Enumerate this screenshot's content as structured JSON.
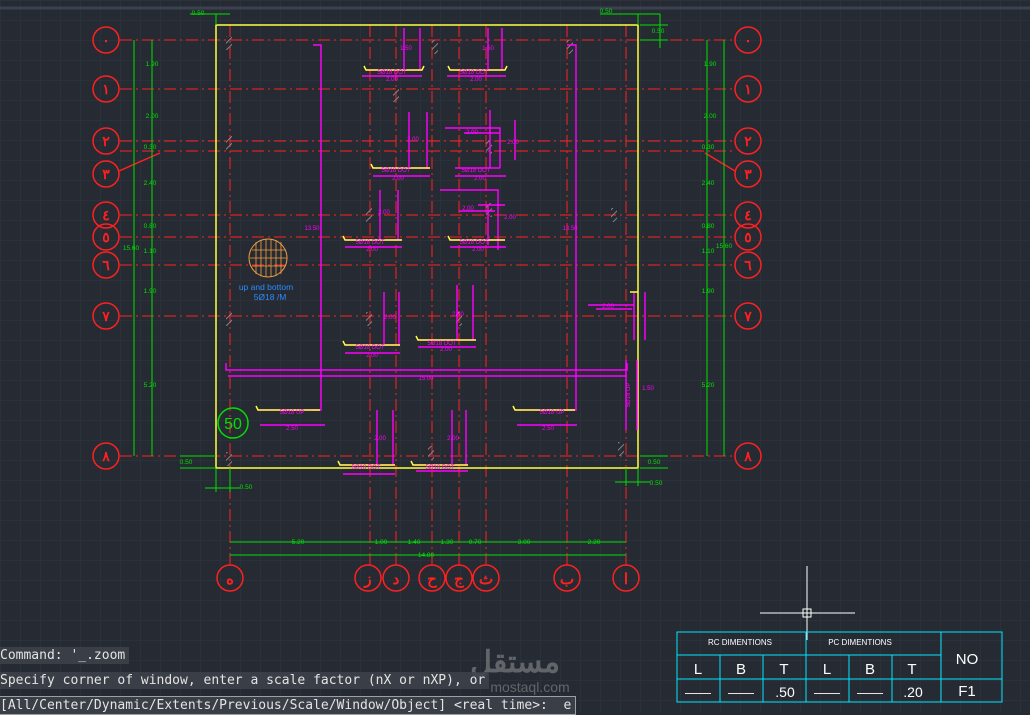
{
  "drawing": {
    "row_labels": [
      "٠",
      "١",
      "٢",
      "٣",
      "٤",
      "٥",
      "٦",
      "٧",
      "٨"
    ],
    "col_labels": [
      "ه",
      "ز",
      "د",
      "ح",
      "ج",
      "ث",
      "ب",
      "ا"
    ],
    "left_dims": [
      "1.90",
      "2.00",
      "0.30",
      "2.40",
      "0.80",
      "1.10",
      "1.90",
      "5.20"
    ],
    "right_dims": [
      "1.90",
      "2.00",
      "0.30",
      "2.40",
      "0.80",
      "1.10",
      "1.90",
      "5.20"
    ],
    "overall_v": "15.60",
    "bottom_dims": [
      "5.20",
      "1.00",
      "1.40",
      "1.30",
      "0.70",
      "3.00",
      "2.20"
    ],
    "overall_h": "14.80",
    "edge_dims": [
      "0.50",
      "0.50",
      "0.50",
      "0.50",
      "0.50",
      "0.50",
      "0.50"
    ],
    "span_15": "15.00",
    "span_1350": "13.50",
    "column_note_line1": "up and bottom",
    "column_note_line2": "5Ø18 /M",
    "slab_thickness": "50",
    "bar_labels": [
      "5Ø18 DOT",
      "5Ø18 DOT",
      "5Ø18 DOT",
      "5Ø18 DOT",
      "5Ø18 DOT",
      "5Ø18 DOT",
      "5Ø18 DOT",
      "5Ø18 UP",
      "5Ø18 UP",
      "5Ø18 DOT",
      "5Ø18 DOT",
      "5Ø18 UP"
    ],
    "small_dims": [
      "1.50",
      "1.50",
      "2.00",
      "2.00",
      "2.00",
      "2.00",
      "2.00",
      "2.00",
      "2.00",
      "2.00",
      "2.00",
      "2.00",
      "2.00",
      "2.00",
      "2.00",
      "2.00",
      "2.00",
      "2.00",
      "2.50",
      "2.50",
      "1.50",
      "2.00",
      "2.00",
      "2.00"
    ]
  },
  "command": {
    "line1": "Command: '_.zoom",
    "line2": "Specify corner of window, enter a scale factor (nX or nXP), or",
    "line3": "[All/Center/Dynamic/Extents/Previous/Scale/Window/Object] <real time>:  e"
  },
  "table": {
    "rc_header": "RC DIMENTIONS",
    "pc_header": "PC DIMENTIONS",
    "no_header": "NO",
    "rc_cols": [
      "L",
      "B",
      "T"
    ],
    "pc_cols": [
      "L",
      "B",
      "T"
    ],
    "rc_values": [
      "——",
      "——",
      ".50"
    ],
    "pc_values": [
      "——",
      "——",
      ".20"
    ],
    "no_value": "F1"
  },
  "watermark": {
    "arabic": "مستقل",
    "latin": "mostaql.com"
  },
  "colors": {
    "background": "#262b33",
    "grid": "#2f3640",
    "axis": "#ff2020",
    "rebar": "#ff00ff",
    "dim": "#00e000",
    "footing": "#ffff40",
    "table": "#00e5ff"
  }
}
